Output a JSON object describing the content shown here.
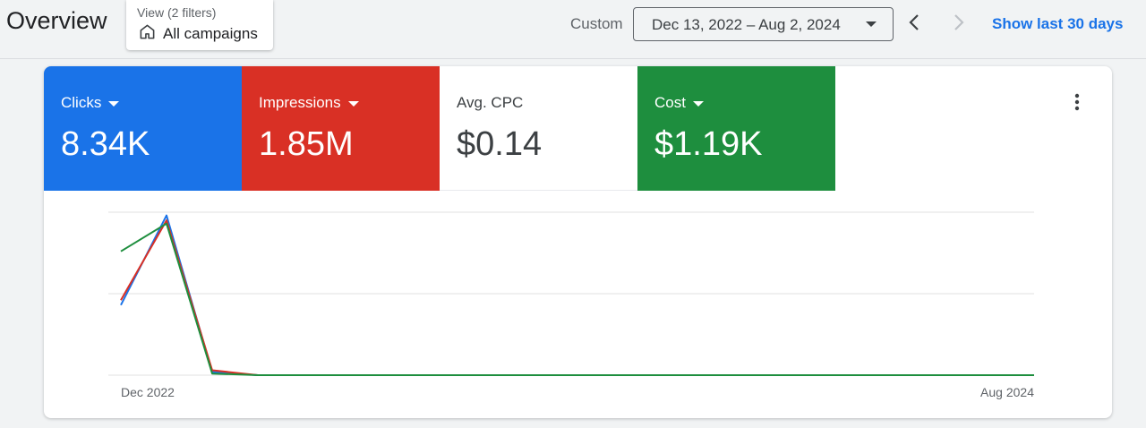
{
  "header": {
    "title": "Overview",
    "view_filter": {
      "subtitle": "View (2 filters)",
      "label": "All campaigns",
      "icon": "home-icon"
    },
    "custom_label": "Custom",
    "date_range": "Dec 13, 2022 – Aug 2, 2024",
    "show_last_label": "Show last 30 days"
  },
  "metrics": [
    {
      "label": "Clicks",
      "value": "8.34K",
      "color": "#1a73e8",
      "dropdown": true
    },
    {
      "label": "Impressions",
      "value": "1.85M",
      "color": "#d93025",
      "dropdown": true
    },
    {
      "label": "Avg. CPC",
      "value": "$0.14",
      "color": "#ffffff",
      "dropdown": false
    },
    {
      "label": "Cost",
      "value": "$1.19K",
      "color": "#1e8e3e",
      "dropdown": true
    }
  ],
  "chart_data": {
    "type": "line",
    "x_tick_labels": [
      "Dec 2022",
      "Aug 2024"
    ],
    "y_gridlines": 3,
    "series": [
      {
        "metric": "Clicks",
        "color": "#1a73e8",
        "values": [
          0.43,
          0.98,
          0.02,
          0,
          0,
          0,
          0,
          0,
          0,
          0,
          0,
          0,
          0,
          0,
          0,
          0,
          0,
          0,
          0,
          0,
          0
        ]
      },
      {
        "metric": "Impressions",
        "color": "#d93025",
        "values": [
          0.46,
          0.95,
          0.03,
          0,
          0,
          0,
          0,
          0,
          0,
          0,
          0,
          0,
          0,
          0,
          0,
          0,
          0,
          0,
          0,
          0,
          0
        ]
      },
      {
        "metric": "Cost",
        "color": "#1e8e3e",
        "values": [
          0.76,
          0.93,
          0.01,
          0,
          0,
          0,
          0,
          0,
          0,
          0,
          0,
          0,
          0,
          0,
          0,
          0,
          0,
          0,
          0,
          0,
          0
        ]
      }
    ]
  }
}
